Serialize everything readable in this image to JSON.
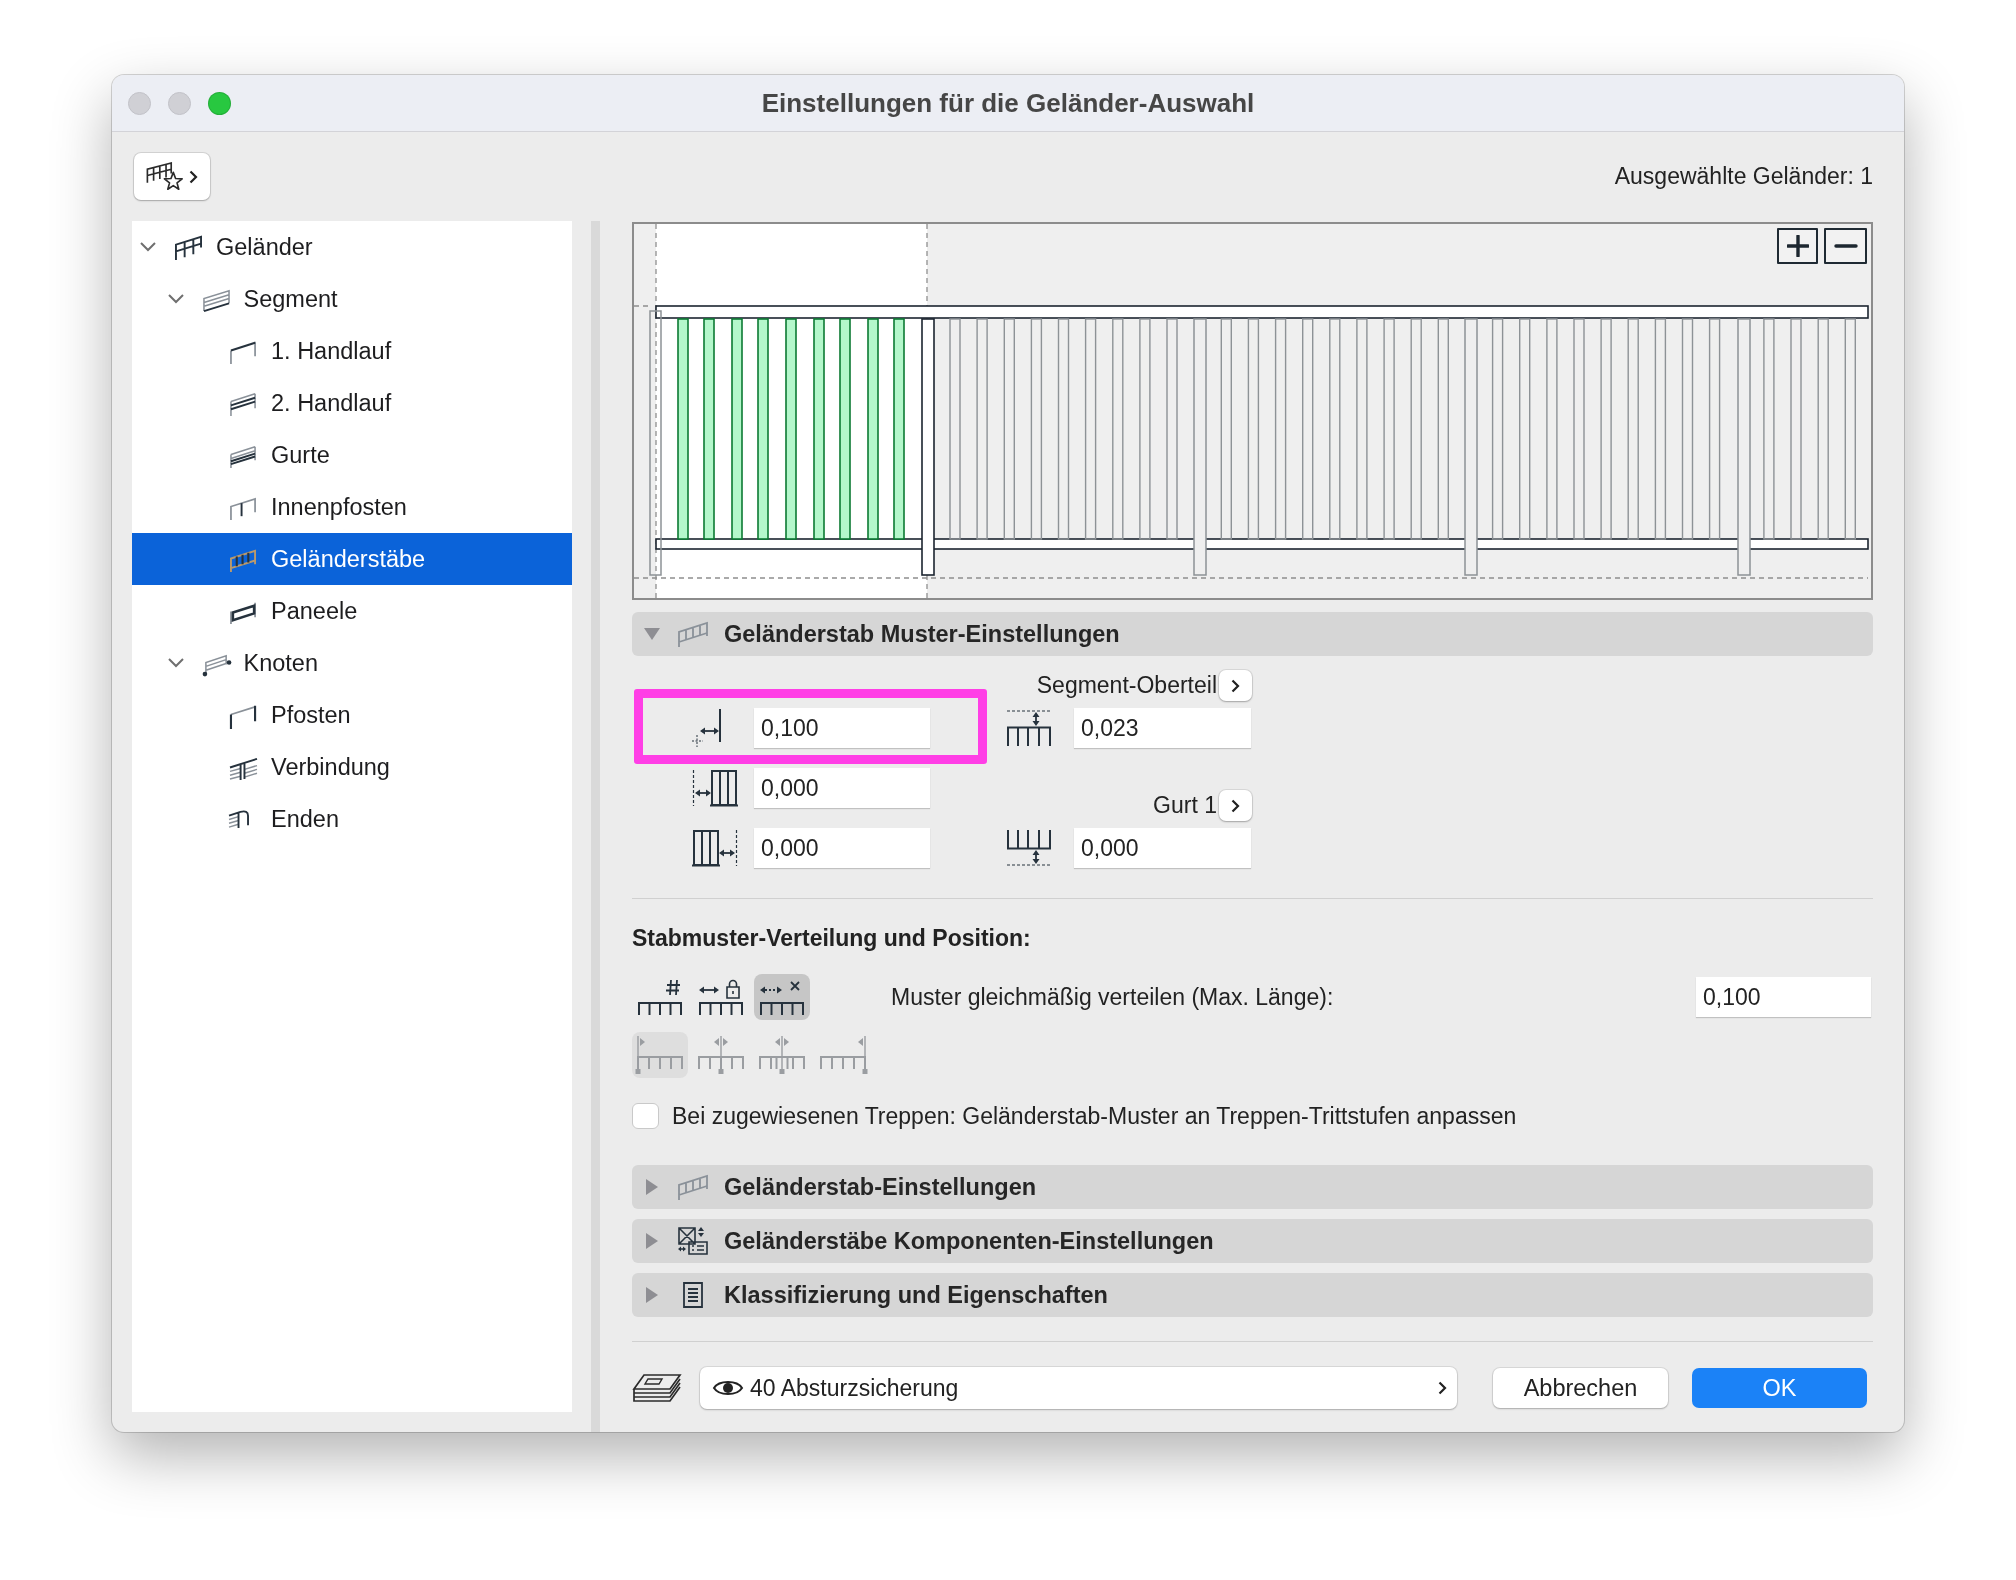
{
  "window": {
    "title": "Einstellungen für die Geländer-Auswahl",
    "controls": [
      {
        "kind": "close",
        "disabled": true
      },
      {
        "kind": "minimize",
        "disabled": true
      },
      {
        "kind": "zoom",
        "disabled": false
      }
    ]
  },
  "toolbar": {
    "selection_count": "Ausgewählte Geländer: 1"
  },
  "tree": [
    {
      "label": "Geländer",
      "kind": "railing",
      "expanded": true,
      "selected": false,
      "children": [
        {
          "label": "Segment",
          "kind": "segment",
          "expanded": true,
          "selected": false,
          "children": [
            {
              "label": "1. Handlauf",
              "kind": "handrail",
              "selected": false
            },
            {
              "label": "2. Handlauf",
              "kind": "double-rail",
              "selected": false
            },
            {
              "label": "Gurte",
              "kind": "rails",
              "selected": false
            },
            {
              "label": "Innenpfosten",
              "kind": "inner-post",
              "selected": false
            },
            {
              "label": "Geländerstäbe",
              "kind": "balusters",
              "selected": true
            },
            {
              "label": "Paneele",
              "kind": "panel",
              "selected": false
            }
          ]
        },
        {
          "label": "Knoten",
          "kind": "nodes",
          "expanded": true,
          "selected": false,
          "children": [
            {
              "label": "Pfosten",
              "kind": "post",
              "selected": false
            },
            {
              "label": "Verbindung",
              "kind": "connection",
              "selected": false
            },
            {
              "label": "Enden",
              "kind": "ends",
              "selected": false
            }
          ]
        }
      ]
    }
  ],
  "pattern_section": {
    "title": "Geländerstab Muster-Einstellungen",
    "expanded": true,
    "left_fields": [
      {
        "kind": "spacing",
        "value": "0,100",
        "highlighted": true
      },
      {
        "kind": "start-offset",
        "value": "0,000",
        "highlighted": false
      },
      {
        "kind": "end-offset",
        "value": "0,000",
        "highlighted": false
      }
    ],
    "right_groups": [
      {
        "label": "Segment-Oberteil",
        "kind": "top-gap",
        "value": "0,023"
      },
      {
        "label": "Gurt 1",
        "kind": "bottom-gap",
        "value": "0,000"
      }
    ]
  },
  "distribution": {
    "title": "Stabmuster-Verteilung und Position:",
    "modes": [
      {
        "kind": "count",
        "selected": false
      },
      {
        "kind": "fixed",
        "selected": false
      },
      {
        "kind": "max-length",
        "selected": true
      }
    ],
    "mode_label": "Muster gleichmäßig verteilen (Max. Länge):",
    "mode_value": "0,100",
    "alignments": [
      {
        "kind": "start",
        "selected": true,
        "disabled": true
      },
      {
        "kind": "center",
        "selected": false,
        "disabled": true
      },
      {
        "kind": "center-split",
        "selected": false,
        "disabled": true
      },
      {
        "kind": "end",
        "selected": false,
        "disabled": true
      }
    ],
    "stair_option": {
      "label": "Bei zugewiesenen Treppen: Geländerstab-Muster an Treppen-Trittstufen anpassen",
      "checked": false
    }
  },
  "sections": [
    {
      "title": "Geländerstab-Einstellungen",
      "kind": "baluster",
      "expanded": false
    },
    {
      "title": "Geländerstäbe Komponenten-Einstellungen",
      "kind": "components",
      "expanded": false
    },
    {
      "title": "Klassifizierung und Eigenschaften",
      "kind": "document",
      "expanded": false
    }
  ],
  "footer": {
    "layer": "40 Absturzsicherung",
    "buttons": [
      {
        "label": "Abbrechen",
        "kind": "secondary"
      },
      {
        "label": "OK",
        "kind": "primary"
      }
    ]
  }
}
